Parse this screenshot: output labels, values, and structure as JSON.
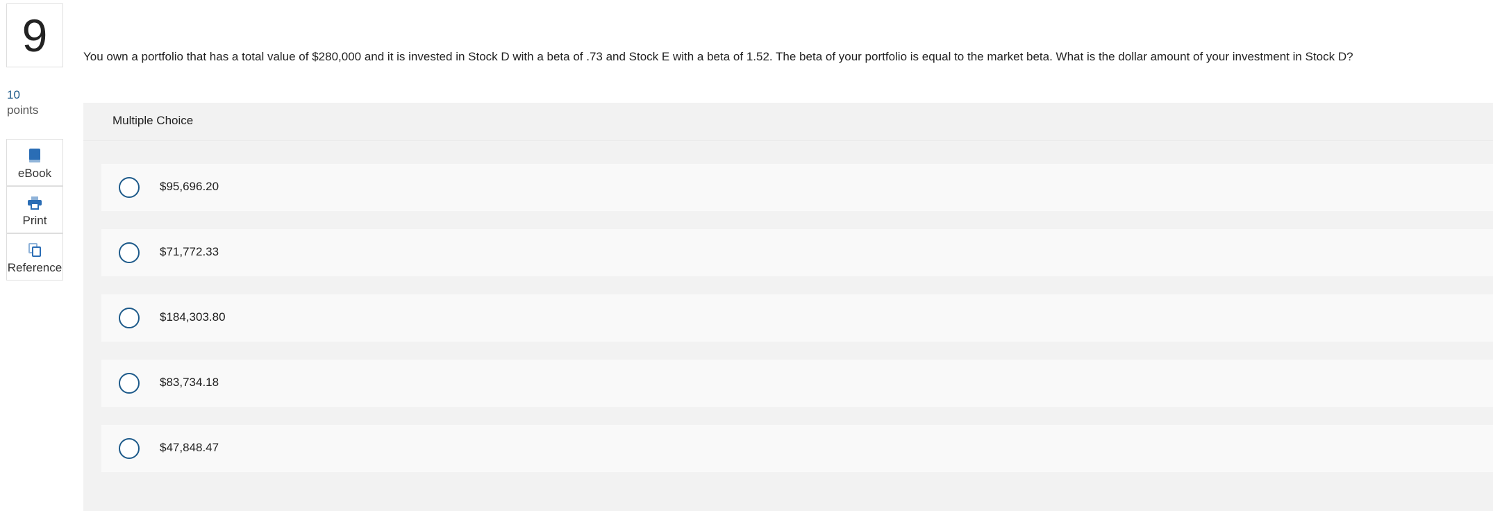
{
  "question": {
    "number": "9",
    "points_value": "10",
    "points_label": "points",
    "text": "You own a portfolio that has a total value of $280,000 and it is invested in Stock D with a beta of .73 and Stock E with a beta of 1.52. The beta of your portfolio is equal to the market beta. What is the dollar amount of your investment in Stock D?"
  },
  "tools": {
    "ebook": {
      "label": "eBook",
      "icon": "book-icon"
    },
    "print": {
      "label": "Print",
      "icon": "printer-icon"
    },
    "reference": {
      "label": "Reference",
      "icon": "copy-icon"
    }
  },
  "answer_panel": {
    "header": "Multiple Choice",
    "options": [
      {
        "label": "$95,696.20",
        "selected": false
      },
      {
        "label": "$71,772.33",
        "selected": false
      },
      {
        "label": "$184,303.80",
        "selected": false
      },
      {
        "label": "$83,734.18",
        "selected": false
      },
      {
        "label": "$47,848.47",
        "selected": false
      }
    ]
  },
  "colors": {
    "accent": "#1d5a8a",
    "panel_bg": "#f2f2f2",
    "option_bg": "#f9f9f9",
    "icon_blue": "#2a6db5"
  }
}
